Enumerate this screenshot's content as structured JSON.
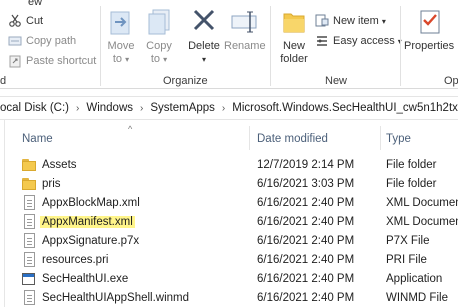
{
  "ribbon": {
    "top_cut_text": "ew",
    "clipboard": {
      "cut": "Cut",
      "copy_path": "Copy path",
      "paste_shortcut": "Paste shortcut"
    },
    "organize": {
      "move_to": "Move",
      "move_to_2": "to",
      "copy_to": "Copy",
      "copy_to_2": "to",
      "delete": "Delete",
      "rename": "Rename",
      "group_label": "Organize"
    },
    "new": {
      "new_folder": "New",
      "new_folder_2": "folder",
      "new_item": "New item",
      "easy_access": "Easy access",
      "group_label": "New"
    },
    "open": {
      "properties": "Properties",
      "group_label": "Op"
    },
    "clipboard_group_label": "d"
  },
  "address": {
    "crumbs": [
      "ocal Disk (C:)",
      "Windows",
      "SystemApps",
      "Microsoft.Windows.SecHealthUI_cw5n1h2txyewy"
    ]
  },
  "columns": {
    "name": "Name",
    "date_modified": "Date modified",
    "type": "Type"
  },
  "files": [
    {
      "name": "Assets",
      "date": "12/7/2019 2:14 PM",
      "type": "File folder",
      "icon": "folder-icon"
    },
    {
      "name": "pris",
      "date": "6/16/2021 3:03 PM",
      "type": "File folder",
      "icon": "folder-icon"
    },
    {
      "name": "AppxBlockMap.xml",
      "date": "6/16/2021 2:40 PM",
      "type": "XML Document",
      "icon": "xml-file-icon"
    },
    {
      "name": "AppxManifest.xml",
      "date": "6/16/2021 2:40 PM",
      "type": "XML Document",
      "icon": "xml-file-icon"
    },
    {
      "name": "AppxSignature.p7x",
      "date": "6/16/2021 2:40 PM",
      "type": "P7X File",
      "icon": "file-icon"
    },
    {
      "name": "resources.pri",
      "date": "6/16/2021 2:40 PM",
      "type": "PRI File",
      "icon": "file-icon"
    },
    {
      "name": "SecHealthUI.exe",
      "date": "6/16/2021 2:40 PM",
      "type": "Application",
      "icon": "exe-icon"
    },
    {
      "name": "SecHealthUIAppShell.winmd",
      "date": "6/16/2021 2:40 PM",
      "type": "WINMD File",
      "icon": "file-icon"
    }
  ],
  "highlight_color": "#fff58a"
}
